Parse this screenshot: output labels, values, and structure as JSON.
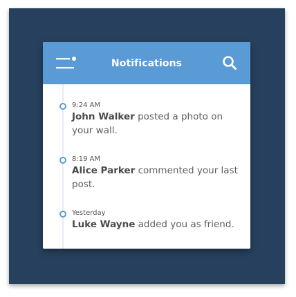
{
  "header": {
    "title": "Notifications",
    "menu_icon": "menu-icon",
    "search_icon": "search-icon",
    "color": "#5b9bd5"
  },
  "notifications": [
    {
      "time": "9:24 AM",
      "name": "John Walker",
      "message": "posted a photo on your wall."
    },
    {
      "time": "8:19 AM",
      "name": "Alice Parker",
      "message": "commented your last post."
    },
    {
      "time": "Yesterday",
      "name": "Luke Wayne",
      "message": "added you as friend."
    }
  ],
  "colors": {
    "background": "#27405e",
    "accent": "#5b9bd5"
  }
}
